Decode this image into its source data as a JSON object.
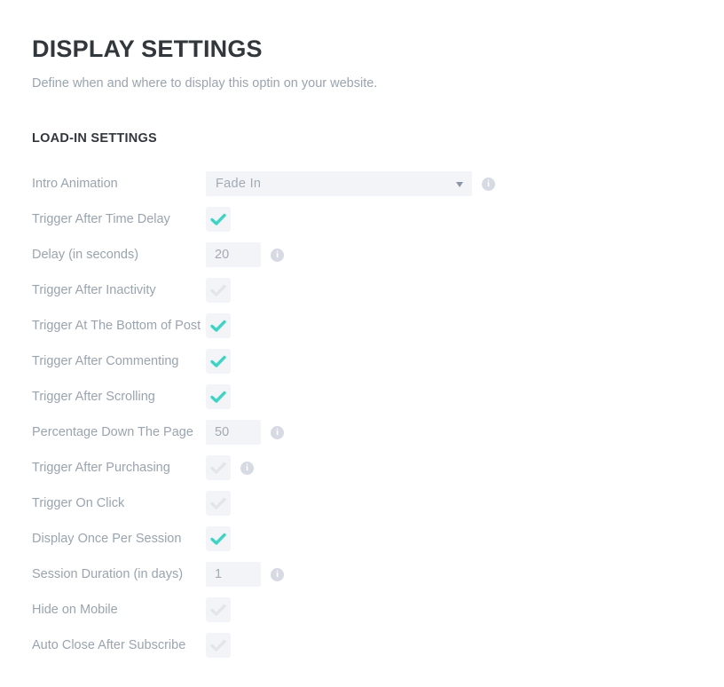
{
  "header": {
    "title": "DISPLAY SETTINGS",
    "subtitle": "Define when and where to display this optin on your website."
  },
  "section": {
    "title": "LOAD-IN SETTINGS"
  },
  "colors": {
    "heading": "#32373c",
    "label": "#9aa4ae",
    "field_bg": "#f2f4f7",
    "check_on": "#3ed3c3",
    "check_off": "#e2e6ec",
    "info_icon": "#d6dae2",
    "select_arrow": "#8b97a8"
  },
  "rows": [
    {
      "label": "Intro Animation",
      "control": "select",
      "value": "Fade In",
      "options": [
        "Fade In"
      ],
      "info": true,
      "name": "intro-animation"
    },
    {
      "label": "Trigger After Time Delay",
      "control": "checkbox",
      "checked": true,
      "info": false,
      "name": "trigger-after-time-delay"
    },
    {
      "label": "Delay (in seconds)",
      "control": "number",
      "value": "20",
      "info": true,
      "name": "delay-in-seconds"
    },
    {
      "label": "Trigger After Inactivity",
      "control": "checkbox",
      "checked": false,
      "info": false,
      "name": "trigger-after-inactivity"
    },
    {
      "label": "Trigger At The Bottom of Post",
      "control": "checkbox",
      "checked": true,
      "info": false,
      "name": "trigger-at-the-bottom-of-post"
    },
    {
      "label": "Trigger After Commenting",
      "control": "checkbox",
      "checked": true,
      "info": false,
      "name": "trigger-after-commenting"
    },
    {
      "label": "Trigger After Scrolling",
      "control": "checkbox",
      "checked": true,
      "info": false,
      "name": "trigger-after-scrolling"
    },
    {
      "label": "Percentage Down The Page",
      "control": "number",
      "value": "50",
      "info": true,
      "name": "percentage-down-the-page"
    },
    {
      "label": "Trigger After Purchasing",
      "control": "checkbox",
      "checked": false,
      "info": true,
      "name": "trigger-after-purchasing"
    },
    {
      "label": "Trigger On Click",
      "control": "checkbox",
      "checked": false,
      "info": false,
      "name": "trigger-on-click"
    },
    {
      "label": "Display Once Per Session",
      "control": "checkbox",
      "checked": true,
      "info": false,
      "name": "display-once-per-session"
    },
    {
      "label": "Session Duration (in days)",
      "control": "number",
      "value": "1",
      "info": true,
      "name": "session-duration-in-days"
    },
    {
      "label": "Hide on Mobile",
      "control": "checkbox",
      "checked": false,
      "info": false,
      "name": "hide-on-mobile"
    },
    {
      "label": "Auto Close After Subscribe",
      "control": "checkbox",
      "checked": false,
      "info": false,
      "name": "auto-close-after-subscribe"
    }
  ]
}
